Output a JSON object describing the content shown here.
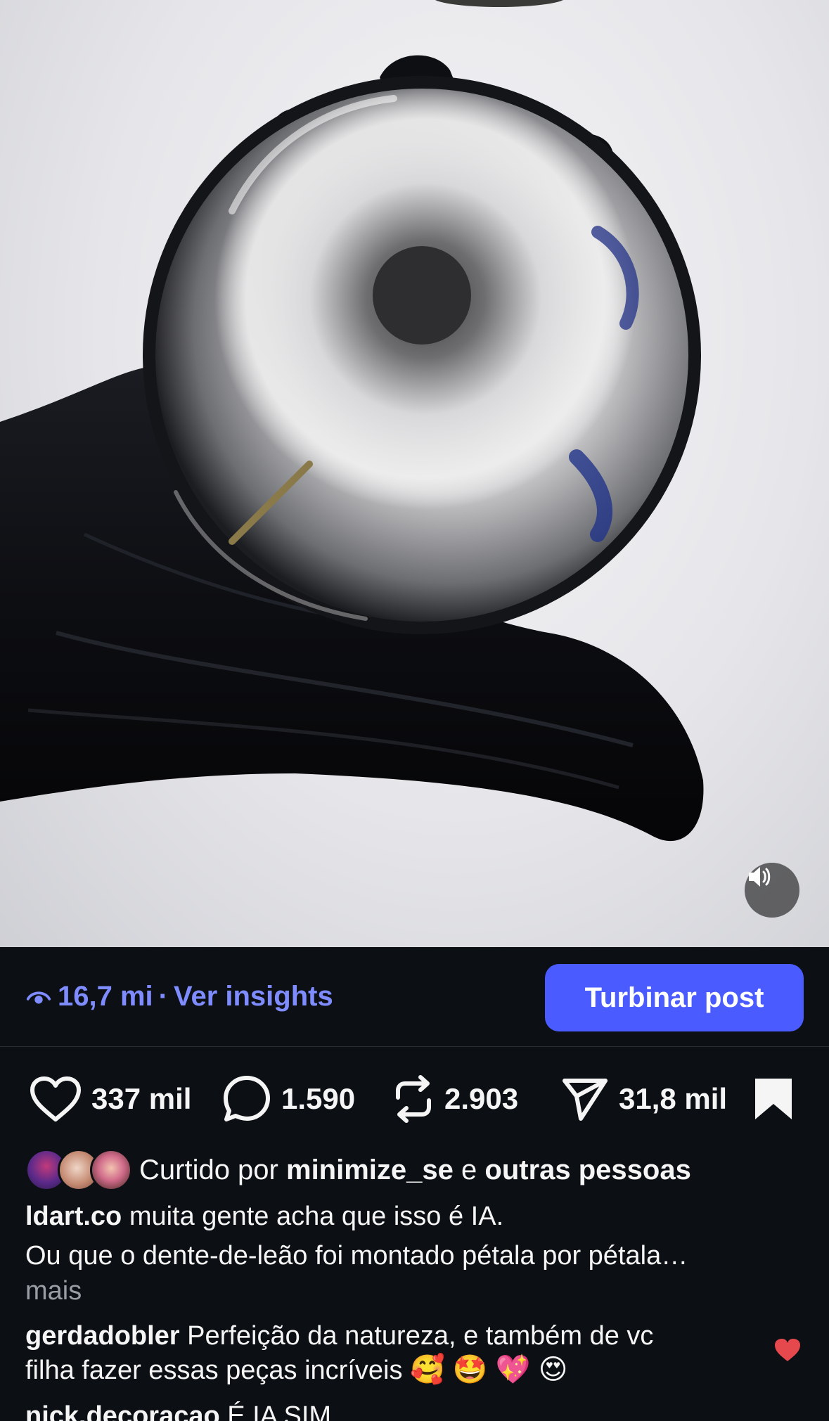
{
  "insights": {
    "views": "16,7 mi",
    "separator": "·",
    "link_label": "Ver insights",
    "boost_label": "Turbinar post"
  },
  "actions": {
    "likes": "337 mil",
    "comments": "1.590",
    "reposts": "2.903",
    "shares": "31,8 mil"
  },
  "liked_by": {
    "prefix": "Curtido por",
    "user": "minimize_se",
    "conjunction": "e",
    "others": "outras pessoas"
  },
  "caption": {
    "username": "ldart.co",
    "line1": "muita gente acha que isso é IA.",
    "line2": "Ou que o dente-de-leão foi montado pétala por pétala…",
    "more": "mais"
  },
  "comments": [
    {
      "username": "gerdadobler",
      "text1": "Perfeição da natureza,  e também de vc",
      "text2": "filha fazer essas peças incríveis",
      "emojis": "🥰 🤩 💖 😍"
    },
    {
      "username": "nick.decoracao",
      "text1": "É IA SIM"
    }
  ],
  "colors": {
    "background": "#0c0f14",
    "accent": "#7f8cff",
    "button": "#4a5cff",
    "liked_heart": "#e5484d"
  },
  "icons": {
    "views": "eye-icon",
    "like": "heart-icon",
    "comment": "comment-icon",
    "repost": "repost-icon",
    "share": "send-icon",
    "save": "bookmark-icon",
    "mute": "speaker-icon"
  }
}
